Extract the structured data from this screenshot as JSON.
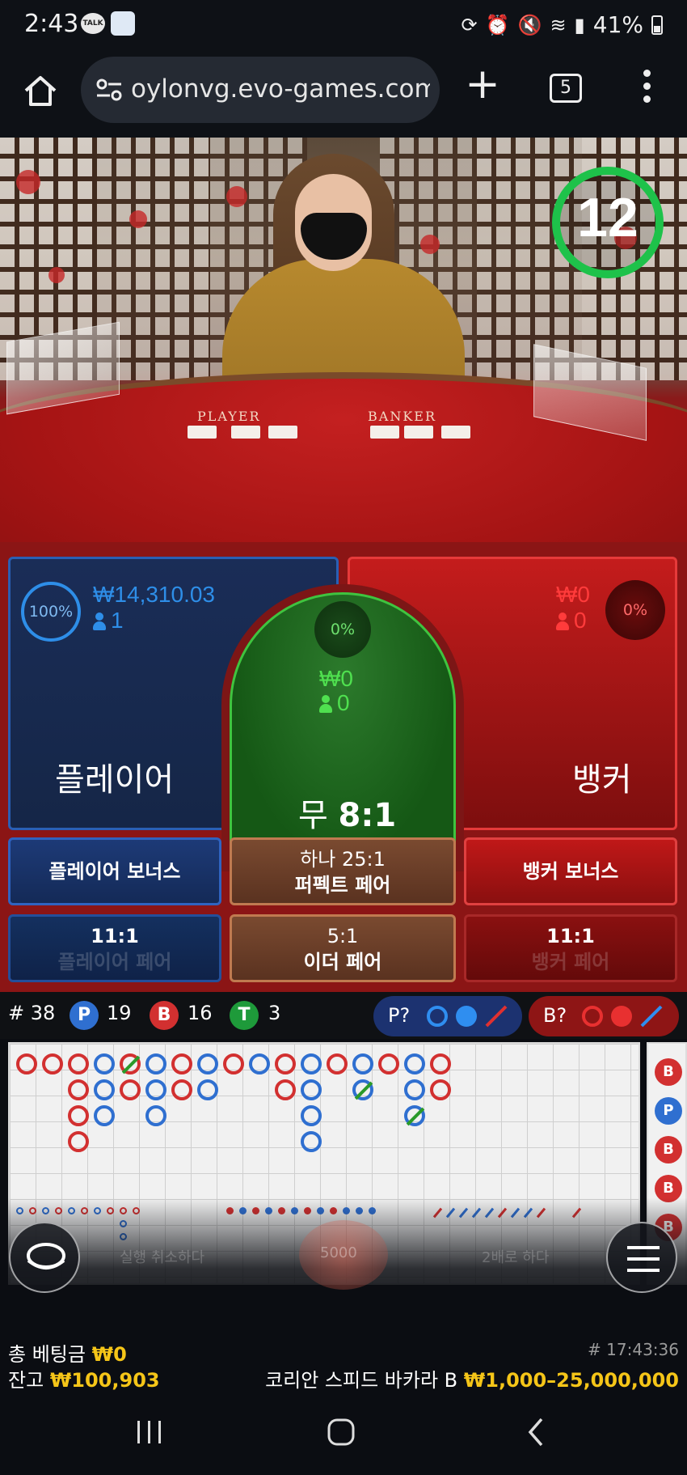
{
  "status_bar": {
    "time": "2:43",
    "talk_icon_text": "TALK",
    "battery": "41%"
  },
  "browser": {
    "url": "oylonvg.evo-games.com",
    "tab_count": "5"
  },
  "video": {
    "table_label_player": "PLAYER",
    "table_label_banker": "BANKER",
    "countdown": "12"
  },
  "bets": {
    "player": {
      "label": "플레이어",
      "percent": "100%",
      "amount": "₩14,310.03",
      "players": "1"
    },
    "tie": {
      "label": "무",
      "payout": "8:1",
      "percent": "0%",
      "amount": "₩0",
      "players": "0"
    },
    "banker": {
      "label": "뱅커",
      "percent": "0%",
      "amount": "₩0",
      "players": "0"
    },
    "player_bonus": "플레이어 보너스",
    "perfect_pair_top": "하나 25:1",
    "perfect_pair_bottom": "퍼펙트 페어",
    "banker_bonus": "뱅커 보너스",
    "player_pair_odds": "11:1",
    "player_pair_label": "플레이어 페어",
    "either_pair_odds": "5:1",
    "either_pair_label": "이더 페어",
    "banker_pair_odds": "11:1",
    "banker_pair_label": "뱅커 페어"
  },
  "stats": {
    "round": "# 38",
    "player_badge": "P",
    "player_count": "19",
    "banker_badge": "B",
    "banker_count": "16",
    "tie_badge": "T",
    "tie_count": "3",
    "player_predict": "P?",
    "banker_predict": "B?"
  },
  "roadmap": {
    "side_beads": [
      "B",
      "P",
      "B",
      "B",
      "B"
    ]
  },
  "controls": {
    "chip_value": "5000",
    "ghost_left": "실행 취소하다",
    "ghost_right": "2배로 하다"
  },
  "footer": {
    "total_bet_label": "총 베팅금",
    "total_bet_value": "₩0",
    "balance_label": "잔고",
    "balance_value": "₩100,903",
    "game_id": "# 17:43:36",
    "table_name": "코리안 스피드 바카라 B",
    "limits": "₩1,000–25,000,000"
  },
  "colors": {
    "player_blue": "#2f6fd0",
    "banker_red": "#d23030",
    "tie_green": "#3fc43f",
    "gold": "#f5c518"
  }
}
